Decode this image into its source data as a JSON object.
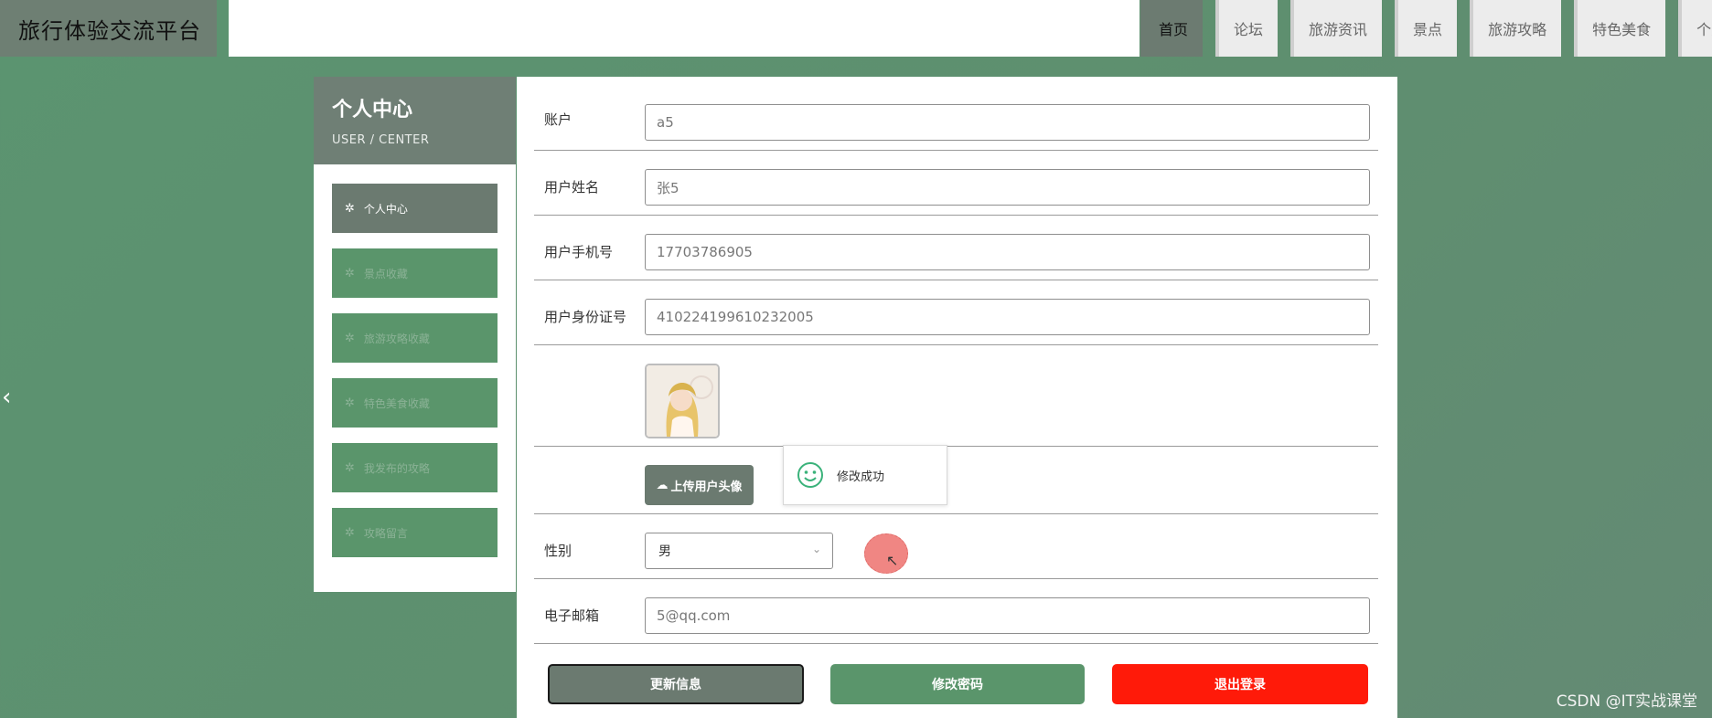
{
  "header": {
    "site_title": "旅行体验交流平台",
    "nav": [
      {
        "label": "首页",
        "active": true
      },
      {
        "label": "论坛"
      },
      {
        "label": "旅游资讯"
      },
      {
        "label": "景点"
      },
      {
        "label": "旅游攻略"
      },
      {
        "label": "特色美食"
      },
      {
        "label": "个人中心"
      }
    ]
  },
  "sidebar": {
    "title": "个人中心",
    "subtitle": "USER / CENTER",
    "icon": "gear-icon",
    "items": [
      {
        "label": "个人中心",
        "active": true
      },
      {
        "label": "景点收藏"
      },
      {
        "label": "旅游攻略收藏"
      },
      {
        "label": "特色美食收藏"
      },
      {
        "label": "我发布的攻略"
      },
      {
        "label": "攻略留言"
      }
    ]
  },
  "form": {
    "account_label": "账户",
    "account_value": "a5",
    "name_label": "用户姓名",
    "name_value": "张5",
    "phone_label": "用户手机号",
    "phone_value": "17703786905",
    "idcard_label": "用户身份证号",
    "idcard_value": "410224199610232005",
    "upload_label": "上传用户头像",
    "gender_label": "性别",
    "gender_value": "男",
    "email_label": "电子邮箱",
    "email_value": "5@qq.com"
  },
  "toast": {
    "message": "修改成功",
    "icon": "smiley-icon"
  },
  "actions": {
    "update": "更新信息",
    "change_password": "修改密码",
    "logout": "退出登录"
  },
  "colors": {
    "background": "#5b9470",
    "dark_accent": "#6b7a70",
    "green_accent": "#5a956b",
    "danger": "#ff1a09"
  },
  "watermark": "CSDN @IT实战课堂"
}
